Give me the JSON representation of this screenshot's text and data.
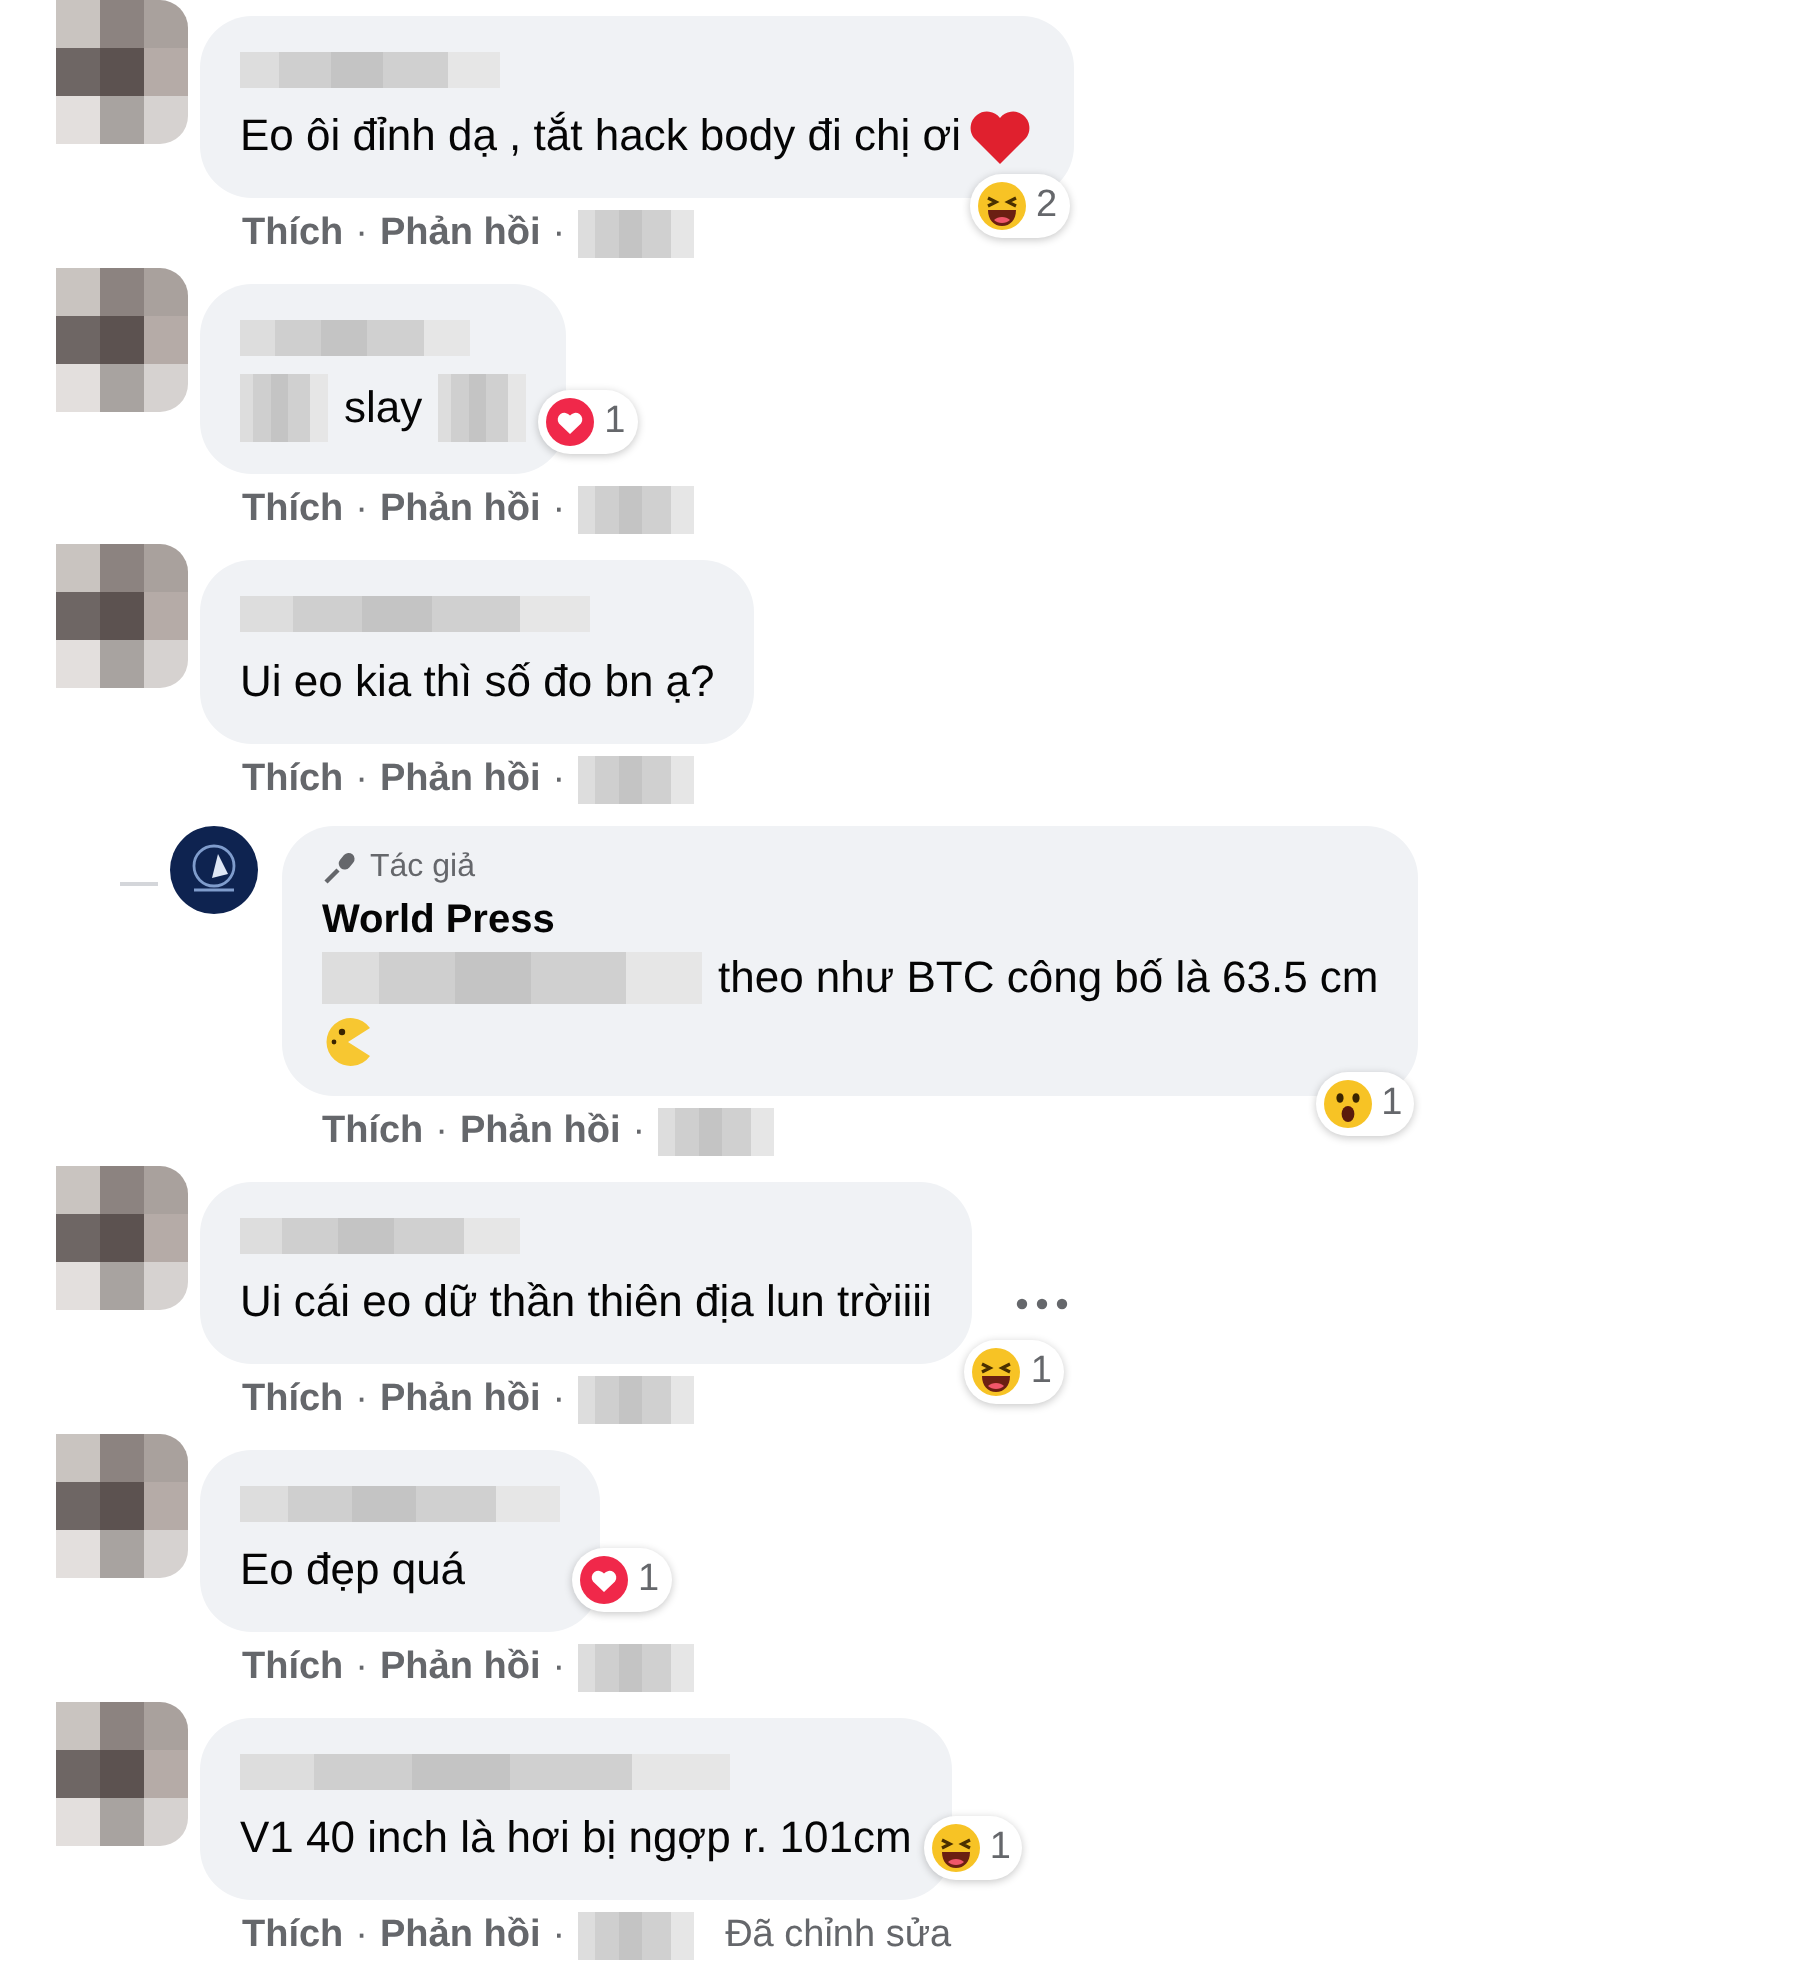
{
  "separator": "·",
  "comments": [
    {
      "segments": [
        {
          "kind": "text",
          "text": "Eo ôi đỉnh dạ , tắt hack body đi chị ơi"
        },
        {
          "kind": "heart"
        }
      ],
      "reaction": {
        "kind": "haha",
        "count": "2",
        "beside": false
      },
      "actions": [
        "Thích",
        "Phản hồi"
      ],
      "menu_visible": false
    },
    {
      "segments": [
        {
          "kind": "blur"
        },
        {
          "kind": "text",
          "text": "slay"
        },
        {
          "kind": "blur"
        }
      ],
      "reaction": {
        "kind": "love",
        "count": "1",
        "beside": true
      },
      "actions": [
        "Thích",
        "Phản hồi"
      ],
      "menu_visible": false
    },
    {
      "segments": [
        {
          "kind": "text",
          "text": "Ui eo kia thì số đo bn ạ?"
        }
      ],
      "actions": [
        "Thích",
        "Phản hồi"
      ],
      "menu_visible": false,
      "replies": [
        {
          "badge": "Tác giả",
          "author": "World Press",
          "segments": [
            {
              "kind": "blur"
            },
            {
              "kind": "text",
              "text": "theo như BTC công bố là 63.5 cm"
            }
          ],
          "emoji_line": {
            "kind": "pacman"
          },
          "reaction": {
            "kind": "wow",
            "count": "1",
            "beside": false
          },
          "actions": [
            "Thích",
            "Phản hồi"
          ]
        }
      ]
    },
    {
      "segments": [
        {
          "kind": "text",
          "text": "Ui cái eo dữ thần thiên địa lun trờiiii"
        }
      ],
      "reaction": {
        "kind": "haha",
        "count": "1",
        "beside": false
      },
      "actions": [
        "Thích",
        "Phản hồi"
      ],
      "menu_visible": true
    },
    {
      "segments": [
        {
          "kind": "text",
          "text": "Eo đẹp quá"
        }
      ],
      "reaction": {
        "kind": "love",
        "count": "1",
        "beside": true
      },
      "actions": [
        "Thích",
        "Phản hồi"
      ],
      "menu_visible": false
    },
    {
      "segments": [
        {
          "kind": "text",
          "text": "V1 40 inch là hơi bị ngợp r. 101cm"
        }
      ],
      "reaction": {
        "kind": "haha",
        "count": "1",
        "beside": true
      },
      "actions": [
        "Thích",
        "Phản hồi"
      ],
      "edited": "Đã chỉnh sửa",
      "menu_visible": false
    }
  ]
}
